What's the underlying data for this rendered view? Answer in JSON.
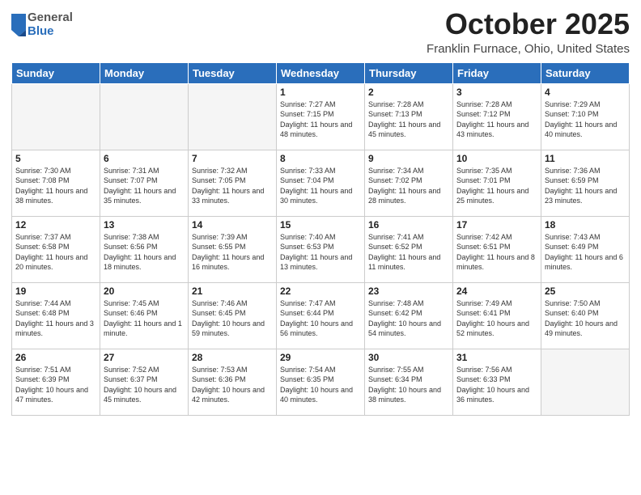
{
  "logo": {
    "general": "General",
    "blue": "Blue"
  },
  "header": {
    "month": "October 2025",
    "location": "Franklin Furnace, Ohio, United States"
  },
  "weekdays": [
    "Sunday",
    "Monday",
    "Tuesday",
    "Wednesday",
    "Thursday",
    "Friday",
    "Saturday"
  ],
  "weeks": [
    [
      {
        "day": "",
        "info": ""
      },
      {
        "day": "",
        "info": ""
      },
      {
        "day": "",
        "info": ""
      },
      {
        "day": "1",
        "info": "Sunrise: 7:27 AM\nSunset: 7:15 PM\nDaylight: 11 hours\nand 48 minutes."
      },
      {
        "day": "2",
        "info": "Sunrise: 7:28 AM\nSunset: 7:13 PM\nDaylight: 11 hours\nand 45 minutes."
      },
      {
        "day": "3",
        "info": "Sunrise: 7:28 AM\nSunset: 7:12 PM\nDaylight: 11 hours\nand 43 minutes."
      },
      {
        "day": "4",
        "info": "Sunrise: 7:29 AM\nSunset: 7:10 PM\nDaylight: 11 hours\nand 40 minutes."
      }
    ],
    [
      {
        "day": "5",
        "info": "Sunrise: 7:30 AM\nSunset: 7:08 PM\nDaylight: 11 hours\nand 38 minutes."
      },
      {
        "day": "6",
        "info": "Sunrise: 7:31 AM\nSunset: 7:07 PM\nDaylight: 11 hours\nand 35 minutes."
      },
      {
        "day": "7",
        "info": "Sunrise: 7:32 AM\nSunset: 7:05 PM\nDaylight: 11 hours\nand 33 minutes."
      },
      {
        "day": "8",
        "info": "Sunrise: 7:33 AM\nSunset: 7:04 PM\nDaylight: 11 hours\nand 30 minutes."
      },
      {
        "day": "9",
        "info": "Sunrise: 7:34 AM\nSunset: 7:02 PM\nDaylight: 11 hours\nand 28 minutes."
      },
      {
        "day": "10",
        "info": "Sunrise: 7:35 AM\nSunset: 7:01 PM\nDaylight: 11 hours\nand 25 minutes."
      },
      {
        "day": "11",
        "info": "Sunrise: 7:36 AM\nSunset: 6:59 PM\nDaylight: 11 hours\nand 23 minutes."
      }
    ],
    [
      {
        "day": "12",
        "info": "Sunrise: 7:37 AM\nSunset: 6:58 PM\nDaylight: 11 hours\nand 20 minutes."
      },
      {
        "day": "13",
        "info": "Sunrise: 7:38 AM\nSunset: 6:56 PM\nDaylight: 11 hours\nand 18 minutes."
      },
      {
        "day": "14",
        "info": "Sunrise: 7:39 AM\nSunset: 6:55 PM\nDaylight: 11 hours\nand 16 minutes."
      },
      {
        "day": "15",
        "info": "Sunrise: 7:40 AM\nSunset: 6:53 PM\nDaylight: 11 hours\nand 13 minutes."
      },
      {
        "day": "16",
        "info": "Sunrise: 7:41 AM\nSunset: 6:52 PM\nDaylight: 11 hours\nand 11 minutes."
      },
      {
        "day": "17",
        "info": "Sunrise: 7:42 AM\nSunset: 6:51 PM\nDaylight: 11 hours\nand 8 minutes."
      },
      {
        "day": "18",
        "info": "Sunrise: 7:43 AM\nSunset: 6:49 PM\nDaylight: 11 hours\nand 6 minutes."
      }
    ],
    [
      {
        "day": "19",
        "info": "Sunrise: 7:44 AM\nSunset: 6:48 PM\nDaylight: 11 hours\nand 3 minutes."
      },
      {
        "day": "20",
        "info": "Sunrise: 7:45 AM\nSunset: 6:46 PM\nDaylight: 11 hours\nand 1 minute."
      },
      {
        "day": "21",
        "info": "Sunrise: 7:46 AM\nSunset: 6:45 PM\nDaylight: 10 hours\nand 59 minutes."
      },
      {
        "day": "22",
        "info": "Sunrise: 7:47 AM\nSunset: 6:44 PM\nDaylight: 10 hours\nand 56 minutes."
      },
      {
        "day": "23",
        "info": "Sunrise: 7:48 AM\nSunset: 6:42 PM\nDaylight: 10 hours\nand 54 minutes."
      },
      {
        "day": "24",
        "info": "Sunrise: 7:49 AM\nSunset: 6:41 PM\nDaylight: 10 hours\nand 52 minutes."
      },
      {
        "day": "25",
        "info": "Sunrise: 7:50 AM\nSunset: 6:40 PM\nDaylight: 10 hours\nand 49 minutes."
      }
    ],
    [
      {
        "day": "26",
        "info": "Sunrise: 7:51 AM\nSunset: 6:39 PM\nDaylight: 10 hours\nand 47 minutes."
      },
      {
        "day": "27",
        "info": "Sunrise: 7:52 AM\nSunset: 6:37 PM\nDaylight: 10 hours\nand 45 minutes."
      },
      {
        "day": "28",
        "info": "Sunrise: 7:53 AM\nSunset: 6:36 PM\nDaylight: 10 hours\nand 42 minutes."
      },
      {
        "day": "29",
        "info": "Sunrise: 7:54 AM\nSunset: 6:35 PM\nDaylight: 10 hours\nand 40 minutes."
      },
      {
        "day": "30",
        "info": "Sunrise: 7:55 AM\nSunset: 6:34 PM\nDaylight: 10 hours\nand 38 minutes."
      },
      {
        "day": "31",
        "info": "Sunrise: 7:56 AM\nSunset: 6:33 PM\nDaylight: 10 hours\nand 36 minutes."
      },
      {
        "day": "",
        "info": ""
      }
    ]
  ]
}
